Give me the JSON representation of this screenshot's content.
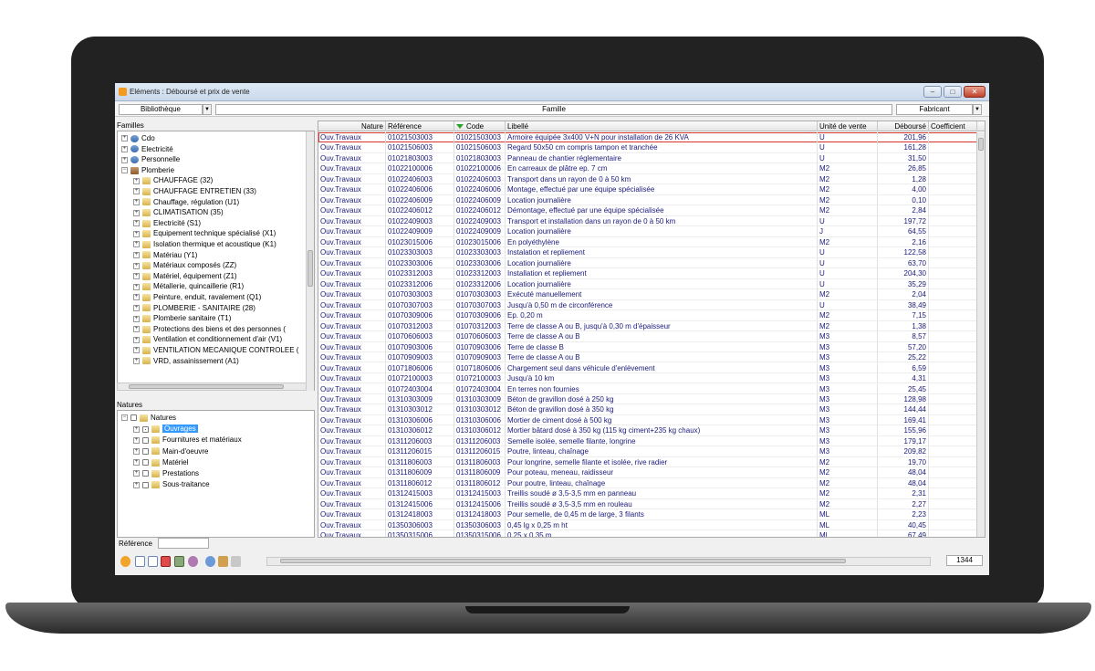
{
  "window": {
    "title": "Eléments : Déboursé et prix de vente"
  },
  "toolbar": {
    "library_label": "Bibliothèque",
    "family_label": "Famille",
    "manufacturer_label": "Fabricant"
  },
  "families": {
    "title": "Familles",
    "items": [
      {
        "label": "Cdo",
        "icon": "person-icon",
        "level": 0,
        "expander": "+"
      },
      {
        "label": "Electricité",
        "icon": "person-icon",
        "level": 0,
        "expander": "+"
      },
      {
        "label": "Personnelle",
        "icon": "person-icon",
        "level": 0,
        "expander": "+"
      },
      {
        "label": "Plomberie",
        "icon": "pipe-icon",
        "level": 0,
        "expander": "−"
      },
      {
        "label": "CHAUFFAGE (32)",
        "icon": "folder-icon",
        "level": 1,
        "expander": "+"
      },
      {
        "label": "CHAUFFAGE ENTRETIEN (33)",
        "icon": "folder-icon",
        "level": 1,
        "expander": "+"
      },
      {
        "label": "Chauffage, régulation (U1)",
        "icon": "folder-icon",
        "level": 1,
        "expander": "+"
      },
      {
        "label": "CLIMATISATION (35)",
        "icon": "folder-icon",
        "level": 1,
        "expander": "+"
      },
      {
        "label": "Electricité (S1)",
        "icon": "folder-icon",
        "level": 1,
        "expander": "+"
      },
      {
        "label": "Equipement technique spécialisé (X1)",
        "icon": "folder-icon",
        "level": 1,
        "expander": "+"
      },
      {
        "label": "Isolation thermique et acoustique (K1)",
        "icon": "folder-icon",
        "level": 1,
        "expander": "+"
      },
      {
        "label": "Matériau (Y1)",
        "icon": "folder-icon",
        "level": 1,
        "expander": "+"
      },
      {
        "label": "Matériaux composés (ZZ)",
        "icon": "folder-icon",
        "level": 1,
        "expander": "+"
      },
      {
        "label": "Matériel, équipement (Z1)",
        "icon": "folder-icon",
        "level": 1,
        "expander": "+"
      },
      {
        "label": "Métallerie, quincaillerie (R1)",
        "icon": "folder-icon",
        "level": 1,
        "expander": "+"
      },
      {
        "label": "Peinture, enduit, ravalement (Q1)",
        "icon": "folder-icon",
        "level": 1,
        "expander": "+"
      },
      {
        "label": "PLOMBERIE - SANITAIRE (28)",
        "icon": "folder-icon",
        "level": 1,
        "expander": "+"
      },
      {
        "label": "Plomberie sanitaire (T1)",
        "icon": "folder-icon",
        "level": 1,
        "expander": "+"
      },
      {
        "label": "Protections des biens et des personnes (",
        "icon": "folder-icon",
        "level": 1,
        "expander": "+"
      },
      {
        "label": "Ventilation et conditionnement d'air (V1)",
        "icon": "folder-icon",
        "level": 1,
        "expander": "+"
      },
      {
        "label": "VENTILATION MECANIQUE CONTROLEE (",
        "icon": "folder-icon",
        "level": 1,
        "expander": "+"
      },
      {
        "label": "VRD, assainissement (A1)",
        "icon": "folder-icon",
        "level": 1,
        "expander": "+"
      }
    ]
  },
  "natures": {
    "title": "Natures",
    "items": [
      {
        "label": "Natures",
        "level": 0,
        "expander": "−",
        "checked": false,
        "selected": false
      },
      {
        "label": "Ouvrages",
        "level": 1,
        "expander": "+",
        "checked": true,
        "selected": true
      },
      {
        "label": "Fournitures et matériaux",
        "level": 1,
        "expander": "+",
        "checked": false,
        "selected": false
      },
      {
        "label": "Main-d'oeuvre",
        "level": 1,
        "expander": "+",
        "checked": false,
        "selected": false
      },
      {
        "label": "Matériel",
        "level": 1,
        "expander": "+",
        "checked": false,
        "selected": false
      },
      {
        "label": "Prestations",
        "level": 1,
        "expander": "+",
        "checked": false,
        "selected": false
      },
      {
        "label": "Sous-traitance",
        "level": 1,
        "expander": "+",
        "checked": false,
        "selected": false
      }
    ]
  },
  "grid": {
    "headers": {
      "nature": "Nature",
      "reference": "Référence",
      "code": "Code",
      "libelle": "Libellé",
      "unite": "Unité de vente",
      "debourse": "Déboursé",
      "coefficient": "Coefficient"
    },
    "rows": [
      [
        "Ouv.Travaux",
        "01021503003",
        "01021503003",
        "Armoire équipée 3x400 V+N pour installation de 26 KVA",
        "U",
        "201,96"
      ],
      [
        "Ouv.Travaux",
        "01021506003",
        "01021506003",
        "Regard 50x50 cm compris tampon et tranchée",
        "U",
        "161,28"
      ],
      [
        "Ouv.Travaux",
        "01021803003",
        "01021803003",
        "Panneau de chantier réglementaire",
        "U",
        "31,50"
      ],
      [
        "Ouv.Travaux",
        "01022100006",
        "01022100006",
        "En carreaux de plâtre ep. 7 cm",
        "M2",
        "26,85"
      ],
      [
        "Ouv.Travaux",
        "01022406003",
        "01022406003",
        "Transport dans un rayon de 0 à 50 km",
        "M2",
        "1,28"
      ],
      [
        "Ouv.Travaux",
        "01022406006",
        "01022406006",
        "Montage, effectué par une équipe spécialisée",
        "M2",
        "4,00"
      ],
      [
        "Ouv.Travaux",
        "01022406009",
        "01022406009",
        "Location journalière",
        "M2",
        "0,10"
      ],
      [
        "Ouv.Travaux",
        "01022406012",
        "01022406012",
        "Démontage, effectué par une équipe spécialisée",
        "M2",
        "2,84"
      ],
      [
        "Ouv.Travaux",
        "01022409003",
        "01022409003",
        "Transport et installation dans un rayon de 0 à 50 km",
        "U",
        "197,72"
      ],
      [
        "Ouv.Travaux",
        "01022409009",
        "01022409009",
        "Location journalière",
        "J",
        "64,55"
      ],
      [
        "Ouv.Travaux",
        "01023015006",
        "01023015006",
        "En polyéthylène",
        "M2",
        "2,16"
      ],
      [
        "Ouv.Travaux",
        "01023303003",
        "01023303003",
        "Instalation et repliement",
        "U",
        "122,58"
      ],
      [
        "Ouv.Travaux",
        "01023303006",
        "01023303006",
        "Location journalière",
        "U",
        "63,70"
      ],
      [
        "Ouv.Travaux",
        "01023312003",
        "01023312003",
        "Installation et repliement",
        "U",
        "204,30"
      ],
      [
        "Ouv.Travaux",
        "01023312006",
        "01023312006",
        "Location journalière",
        "U",
        "35,29"
      ],
      [
        "Ouv.Travaux",
        "01070303003",
        "01070303003",
        "Exécuté manuellement",
        "M2",
        "2,04"
      ],
      [
        "Ouv.Travaux",
        "01070307003",
        "01070307003",
        "Jusqu'à 0,50 m de circonférence",
        "U",
        "38,49"
      ],
      [
        "Ouv.Travaux",
        "01070309006",
        "01070309006",
        "Ep. 0,20 m",
        "M2",
        "7,15"
      ],
      [
        "Ouv.Travaux",
        "01070312003",
        "01070312003",
        "Terre de classe A ou B, jusqu'à 0,30 m d'épaisseur",
        "M2",
        "1,38"
      ],
      [
        "Ouv.Travaux",
        "01070606003",
        "01070606003",
        "Terre de classe A ou B",
        "M3",
        "8,57"
      ],
      [
        "Ouv.Travaux",
        "01070903006",
        "01070903006",
        "Terre de classe B",
        "M3",
        "57,20"
      ],
      [
        "Ouv.Travaux",
        "01070909003",
        "01070909003",
        "Terre de classe A ou B",
        "M3",
        "25,22"
      ],
      [
        "Ouv.Travaux",
        "01071806006",
        "01071806006",
        "Chargement seul dans véhicule d'enlèvement",
        "M3",
        "6,59"
      ],
      [
        "Ouv.Travaux",
        "01072100003",
        "01072100003",
        "Jusqu'à 10 km",
        "M3",
        "4,31"
      ],
      [
        "Ouv.Travaux",
        "01072403004",
        "01072403004",
        "En terres non fournies",
        "M3",
        "25,45"
      ],
      [
        "Ouv.Travaux",
        "01310303009",
        "01310303009",
        "Béton de gravillon dosé à 250 kg",
        "M3",
        "128,98"
      ],
      [
        "Ouv.Travaux",
        "01310303012",
        "01310303012",
        "Béton de gravillon dosé à 350 kg",
        "M3",
        "144,44"
      ],
      [
        "Ouv.Travaux",
        "01310306006",
        "01310306006",
        "Mortier de ciment dosé à 500 kg",
        "M3",
        "169,41"
      ],
      [
        "Ouv.Travaux",
        "01310306012",
        "01310306012",
        "Mortier bâtard dosé à 350 kg (115 kg ciment+235 kg chaux)",
        "M3",
        "155,96"
      ],
      [
        "Ouv.Travaux",
        "01311206003",
        "01311206003",
        "Semelle isolée, semelle filante, longrine",
        "M3",
        "179,17"
      ],
      [
        "Ouv.Travaux",
        "01311206015",
        "01311206015",
        "Poutre, linteau, chaînage",
        "M3",
        "209,82"
      ],
      [
        "Ouv.Travaux",
        "01311806003",
        "01311806003",
        "Pour longrine, semelle filante et isolée, rive radier",
        "M2",
        "19,70"
      ],
      [
        "Ouv.Travaux",
        "01311806009",
        "01311806009",
        "Pour poteau, meneau, raidisseur",
        "M2",
        "48,04"
      ],
      [
        "Ouv.Travaux",
        "01311806012",
        "01311806012",
        "Pour poutre, linteau, chaînage",
        "M2",
        "48,04"
      ],
      [
        "Ouv.Travaux",
        "01312415003",
        "01312415003",
        "Treillis soudé ø 3,5-3,5 mm en panneau",
        "M2",
        "2,31"
      ],
      [
        "Ouv.Travaux",
        "01312415006",
        "01312415006",
        "Treillis soudé ø 3,5-3,5 mm en rouleau",
        "M2",
        "2,27"
      ],
      [
        "Ouv.Travaux",
        "01312418003",
        "01312418003",
        "Pour semelle, de 0,45 m de large, 3 filants",
        "ML",
        "2,23"
      ],
      [
        "Ouv.Travaux",
        "01350306003",
        "01350306003",
        "0,45 lg x 0,25 m ht",
        "ML",
        "40,45"
      ],
      [
        "Ouv.Travaux",
        "01350315006",
        "01350315006",
        "0,25 x 0,35 m",
        "ML",
        "67,49"
      ]
    ]
  },
  "footer": {
    "reference_label": "Référence",
    "reference_value": "",
    "record_count": "1344"
  },
  "colors": {
    "highlight_row": "#d9342b",
    "selection": "#3399ff",
    "sort_indicator": "#2aa22a"
  }
}
